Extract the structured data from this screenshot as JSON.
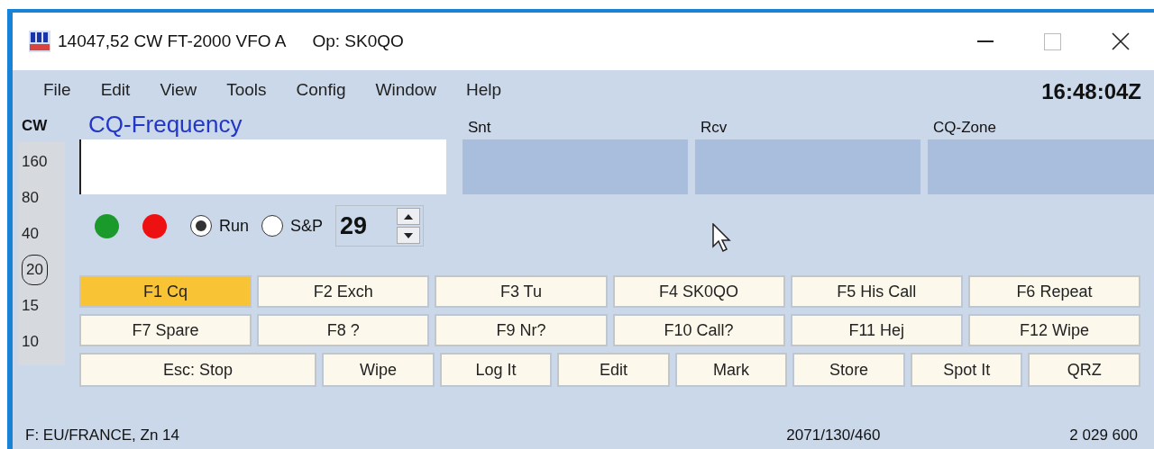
{
  "window": {
    "title": "14047,52 CW FT-2000 VFO A",
    "operator": "Op: SK0QO"
  },
  "menu": [
    "File",
    "Edit",
    "View",
    "Tools",
    "Config",
    "Window",
    "Help"
  ],
  "clock": "16:48:04Z",
  "mode": "CW",
  "bands": [
    {
      "label": "160",
      "selected": false
    },
    {
      "label": "80",
      "selected": false
    },
    {
      "label": "40",
      "selected": false
    },
    {
      "label": "20",
      "selected": true
    },
    {
      "label": "15",
      "selected": false
    },
    {
      "label": "10",
      "selected": false
    }
  ],
  "entry_fields": [
    {
      "label": "CQ-Frequency",
      "kind": "main"
    },
    {
      "label": "Snt",
      "kind": "exchange"
    },
    {
      "label": "Rcv",
      "kind": "exchange"
    },
    {
      "label": "CQ-Zone",
      "kind": "exchange"
    }
  ],
  "indicators": [
    {
      "color": "#1a9a2a"
    },
    {
      "color": "#ee1111"
    }
  ],
  "radios": [
    {
      "label": "Run",
      "selected": true
    },
    {
      "label": "S&P",
      "selected": false
    }
  ],
  "spinner": {
    "value": "29"
  },
  "function_keys": [
    {
      "label": "F1 Cq",
      "selected": true
    },
    {
      "label": "F2 Exch",
      "selected": false
    },
    {
      "label": "F3 Tu",
      "selected": false
    },
    {
      "label": "F4 SK0QO",
      "selected": false
    },
    {
      "label": "F5 His Call",
      "selected": false
    },
    {
      "label": "F6 Repeat",
      "selected": false
    },
    {
      "label": "F7 Spare",
      "selected": false
    },
    {
      "label": "F8 ?",
      "selected": false
    },
    {
      "label": "F9 Nr?",
      "selected": false
    },
    {
      "label": "F10 Call?",
      "selected": false
    },
    {
      "label": "F11 Hej",
      "selected": false
    },
    {
      "label": "F12 Wipe",
      "selected": false
    }
  ],
  "action_buttons": [
    {
      "label": "Esc: Stop",
      "kind": "wide"
    },
    {
      "label": "Wipe",
      "kind": "normal"
    },
    {
      "label": "Log It",
      "kind": "normal"
    },
    {
      "label": "Edit",
      "kind": "normal"
    },
    {
      "label": "Mark",
      "kind": "normal"
    },
    {
      "label": "Store",
      "kind": "normal"
    },
    {
      "label": "Spot It",
      "kind": "normal"
    },
    {
      "label": "QRZ",
      "kind": "normal"
    }
  ],
  "status_bar": {
    "left": "F: EU/FRANCE, Zn 14",
    "center": "2071/130/460",
    "right": "2 029 600"
  }
}
